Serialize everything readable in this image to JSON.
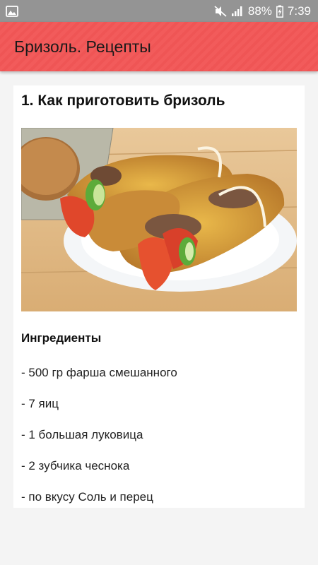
{
  "status_bar": {
    "icons": [
      "image-notification-icon",
      "mute-icon",
      "signal-icon",
      "battery-charging-icon"
    ],
    "battery": "88%",
    "time": "7:39"
  },
  "app_bar": {
    "title": "Бризоль. Рецепты",
    "color": "#f25b5b"
  },
  "recipe": {
    "title": "1. Как приготовить бризоль",
    "image_alt": "бризоль",
    "ingredients_heading": "Ингредиенты",
    "ingredients": [
      "- 500 гр фарша смешанного",
      "- 7 яиц",
      "- 1 большая луковица",
      "- 2 зубчика чеснока",
      "- по вкусу Соль и перец"
    ]
  }
}
